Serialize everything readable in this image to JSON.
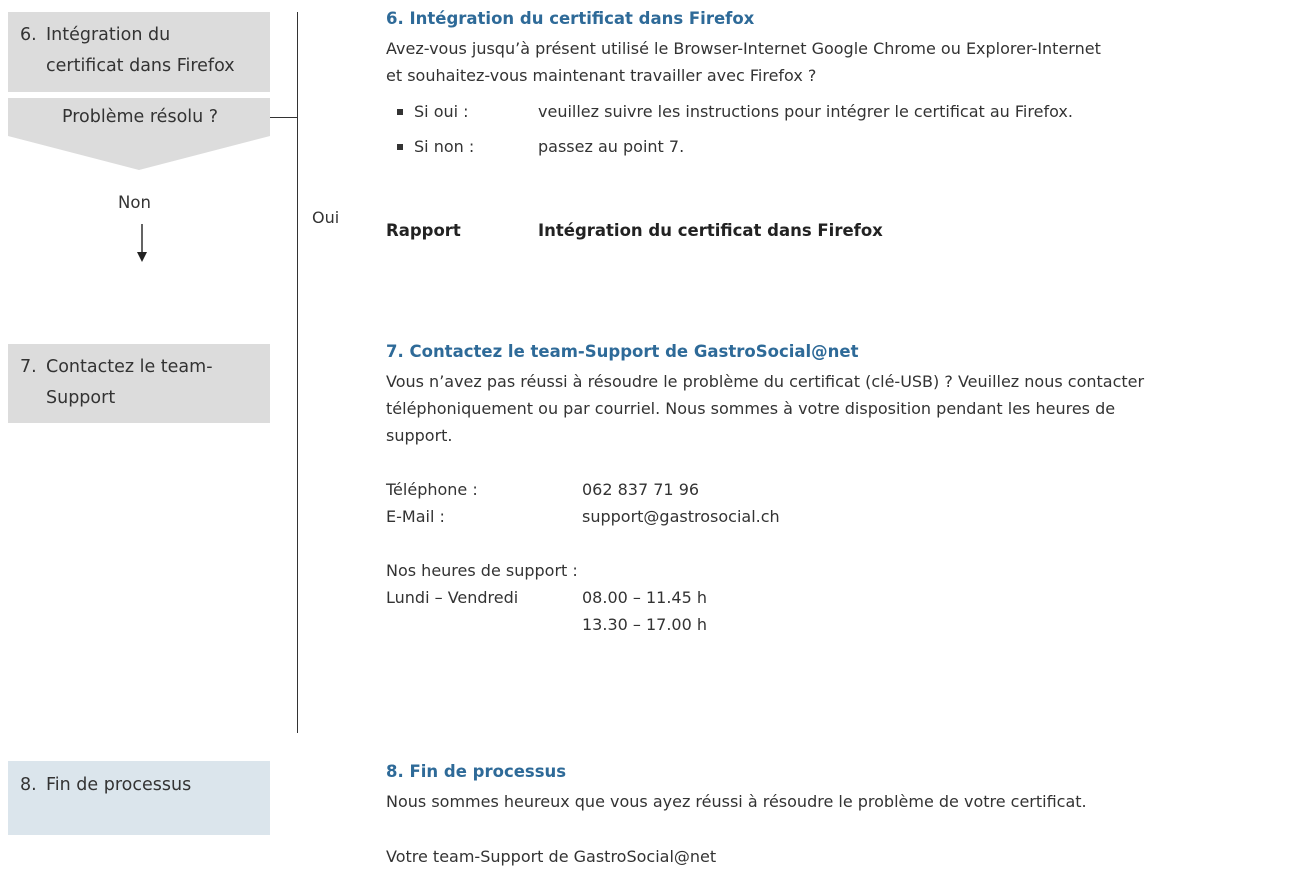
{
  "sidebar": {
    "step6": {
      "number": "6.",
      "line1": "Intégration du",
      "line2": "certificat dans Firefox"
    },
    "decision": {
      "label": "Problème résolu ?"
    },
    "no_label": "Non",
    "yes_label": "Oui",
    "step7": {
      "number": "7.",
      "line1": "Contactez le team-",
      "line2": "Support"
    },
    "step8": {
      "number": "8.",
      "line1": "Fin de processus"
    }
  },
  "section6": {
    "heading": "6. Intégration du certificat dans Firefox",
    "para_line1": "Avez-vous jusqu’à présent utilisé le Browser-Internet Google Chrome ou Explorer-Internet",
    "para_line2": "et souhaitez-vous maintenant travailler avec Firefox ?",
    "bullets": [
      {
        "label": "Si oui :",
        "text": "veuillez suivre les instructions pour intégrer le certificat au Firefox."
      },
      {
        "label": "Si non :",
        "text": "passez au point 7."
      }
    ],
    "report_label": "Rapport",
    "report_title": "Intégration du certificat dans Firefox"
  },
  "section7": {
    "heading": "7. Contactez le team-Support de GastroSocial@net",
    "para_line1": "Vous n’avez pas réussi à résoudre le problème du certificat (clé-USB) ? Veuillez nous contacter",
    "para_line2": "téléphoniquement ou par courriel. Nous sommes à votre disposition pendant les heures de",
    "para_line3": "support.",
    "phone_label": "Téléphone :",
    "phone_value": "062 837 71 96",
    "email_label": "E-Mail :",
    "email_value": "support@gastrosocial.ch",
    "hours_heading": "Nos heures de support :",
    "days_label": "Lundi – Vendredi",
    "hours_1": "08.00 – 11.45 h",
    "hours_2": "13.30 – 17.00 h"
  },
  "section8": {
    "heading": "8. Fin de processus",
    "para": "Nous sommes heureux que vous ayez réussi à résoudre le problème de votre certificat.",
    "signature": "Votre team-Support de GastroSocial@net"
  },
  "colors": {
    "heading": "#2e6a98",
    "box_grey": "#dcdcdc",
    "box_blue": "#dbe5ec"
  }
}
